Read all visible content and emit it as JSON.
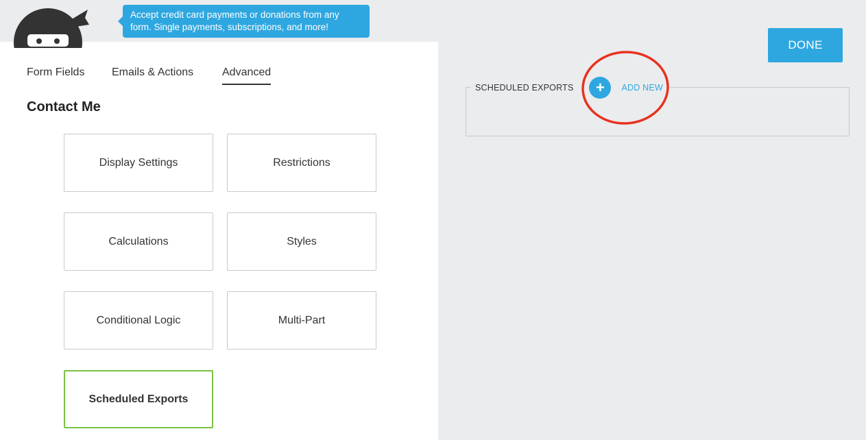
{
  "tooltip": {
    "text": "Accept credit card payments or donations from any form. Single payments, subscriptions, and more!"
  },
  "tabs": [
    {
      "label": "Form Fields",
      "active": false
    },
    {
      "label": "Emails & Actions",
      "active": false
    },
    {
      "label": "Advanced",
      "active": true
    }
  ],
  "form_title": "Contact Me",
  "cards": [
    {
      "label": "Display Settings"
    },
    {
      "label": "Restrictions"
    },
    {
      "label": "Calculations"
    },
    {
      "label": "Styles"
    },
    {
      "label": "Conditional Logic"
    },
    {
      "label": "Multi-Part"
    },
    {
      "label": "Scheduled Exports",
      "active": true
    }
  ],
  "done_label": "DONE",
  "scheduled_exports": {
    "legend": "SCHEDULED EXPORTS",
    "add_icon": "+",
    "add_new_label": "ADD NEW"
  },
  "colors": {
    "accent": "#2ea7e0",
    "active_border": "#7ac143",
    "highlight_ring": "#e8321f",
    "background": "#ebeced"
  },
  "icons": {
    "logo": "ninja-logo-icon",
    "add": "plus-icon"
  }
}
